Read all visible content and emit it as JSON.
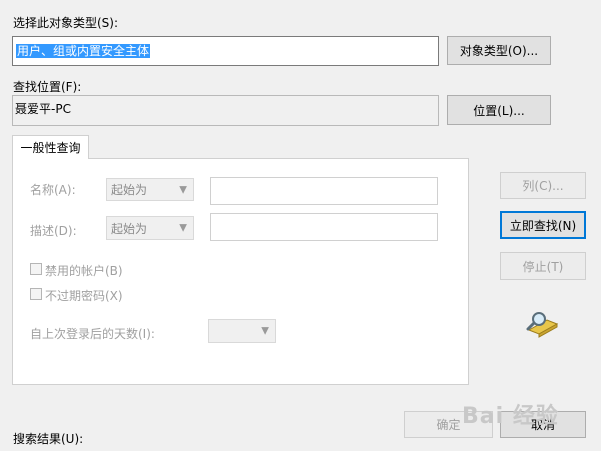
{
  "object_type": {
    "label": "选择此对象类型(S):",
    "value": "用户、组或内置安全主体",
    "button": "对象类型(O)..."
  },
  "location": {
    "label": "查找位置(F):",
    "value": "聂爱平-PC",
    "button": "位置(L)..."
  },
  "tab": {
    "label": "一般性查询"
  },
  "query": {
    "name_label": "名称(A):",
    "name_mode": "起始为",
    "desc_label": "描述(D):",
    "desc_mode": "起始为",
    "disabled_accounts": "禁用的帐户(B)",
    "non_expiring_password": "不过期密码(X)",
    "days_since_logon": "自上次登录后的天数(I):"
  },
  "side_buttons": {
    "columns": "列(C)...",
    "find_now": "立即查找(N)",
    "stop": "停止(T)"
  },
  "footer": {
    "results_label": "搜索结果(U):",
    "ok": "确定",
    "cancel": "取消"
  },
  "watermark": "Bai 经验"
}
